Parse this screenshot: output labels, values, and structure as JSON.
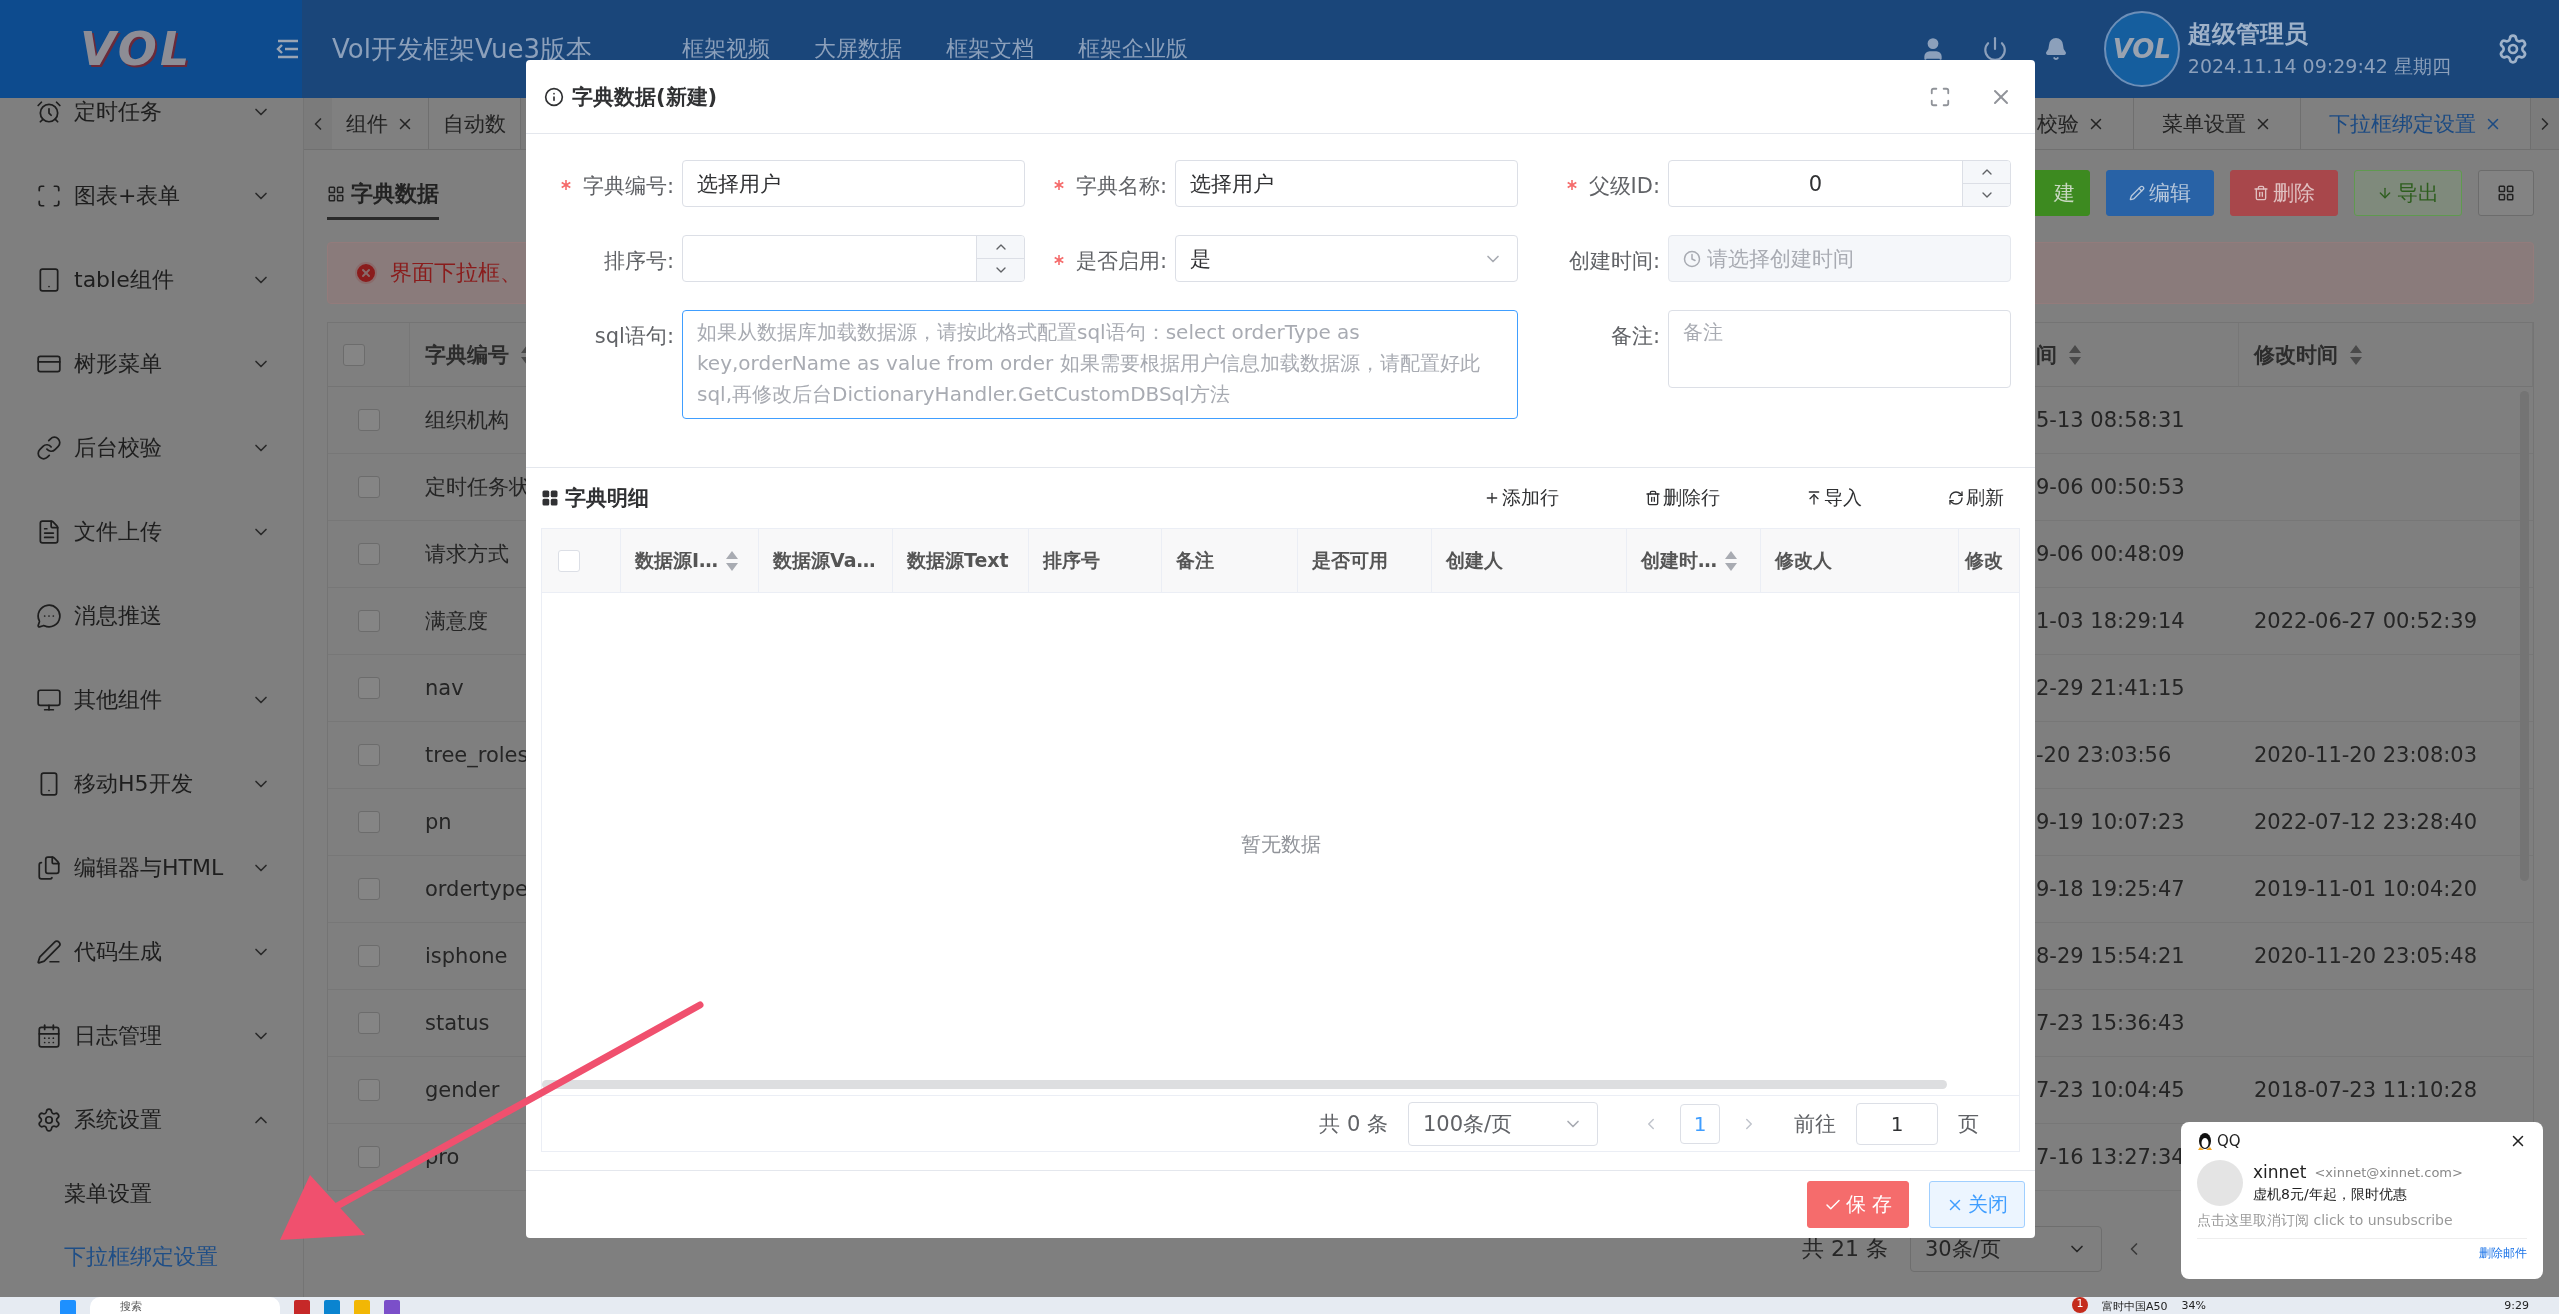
{
  "header": {
    "logo": "VOL",
    "title": "Vol开发框架Vue3版本",
    "nav": [
      "框架视频",
      "大屏数据",
      "框架文档",
      "框架企业版"
    ],
    "user": {
      "avatar_text": "VOL",
      "name": "超级管理员",
      "datetime": "2024.11.14 09:29:42 星期四"
    }
  },
  "sidebar": {
    "items": [
      {
        "kind": "group",
        "label": "定时任务",
        "expanded": false
      },
      {
        "kind": "group",
        "label": "图表+表单",
        "expanded": false
      },
      {
        "kind": "group",
        "label": "table组件",
        "expanded": false
      },
      {
        "kind": "group",
        "label": "树形菜单",
        "expanded": false
      },
      {
        "kind": "group",
        "label": "后台校验",
        "expanded": false
      },
      {
        "kind": "group",
        "label": "文件上传",
        "expanded": false
      },
      {
        "kind": "link",
        "label": "消息推送"
      },
      {
        "kind": "group",
        "label": "其他组件",
        "expanded": false
      },
      {
        "kind": "group",
        "label": "移动H5开发",
        "expanded": false
      },
      {
        "kind": "group",
        "label": "编辑器与HTML",
        "expanded": false
      },
      {
        "kind": "group",
        "label": "代码生成",
        "expanded": false
      },
      {
        "kind": "group",
        "label": "日志管理",
        "expanded": false
      },
      {
        "kind": "group",
        "label": "系统设置",
        "expanded": true,
        "children": [
          {
            "label": "菜单设置",
            "selected": false
          },
          {
            "label": "下拉框绑定设置",
            "selected": true
          }
        ]
      }
    ]
  },
  "tabs": {
    "left": [
      {
        "label": "组件",
        "selected": false,
        "closable": true
      },
      {
        "label": "自动数",
        "selected": false,
        "closable": false
      }
    ],
    "right": [
      {
        "label": "校验",
        "selected": false,
        "closable": true
      },
      {
        "label": "菜单设置",
        "selected": false,
        "closable": true
      },
      {
        "label": "下拉框绑定设置",
        "selected": true,
        "closable": true
      }
    ]
  },
  "content": {
    "title": "字典数据",
    "buttons": [
      {
        "kind": "new",
        "label": "建"
      },
      {
        "kind": "edit",
        "label": "编辑"
      },
      {
        "kind": "delete",
        "label": "删除"
      },
      {
        "kind": "export",
        "label": "导出"
      },
      {
        "kind": "columns"
      }
    ],
    "alert": "界面下拉框、",
    "table": {
      "all_checked": false,
      "columns": [
        {
          "label": "字典编号",
          "sortable": true
        },
        {
          "label": "间",
          "sortable": true
        },
        {
          "label": "修改时间",
          "sortable": true
        }
      ],
      "rows": [
        {
          "checked": false,
          "code": "组织机构",
          "column_2": "5-13 08:58:31"
        },
        {
          "checked": false,
          "code": "定时任务状",
          "column_2": "9-06 00:50:53"
        },
        {
          "checked": false,
          "code": "请求方式",
          "column_2": "9-06 00:48:09"
        },
        {
          "checked": false,
          "code": "满意度",
          "column_2": "1-03 18:29:14",
          "modified": "2022-06-27 00:52:39"
        },
        {
          "checked": false,
          "code": "nav",
          "column_2": "2-29 21:41:15"
        },
        {
          "checked": false,
          "code": "tree_roles",
          "column_2": "-20 23:03:56",
          "modified": "2020-11-20 23:08:03"
        },
        {
          "checked": false,
          "code": "pn",
          "column_2": "9-19 10:07:23",
          "modified": "2022-07-12 23:28:40"
        },
        {
          "checked": false,
          "code": "ordertype",
          "column_2": "9-18 19:25:47",
          "modified": "2019-11-01 10:04:20"
        },
        {
          "checked": false,
          "code": "isphone",
          "column_2": "8-29 15:54:21",
          "modified": "2020-11-20 23:05:48"
        },
        {
          "checked": false,
          "code": "status",
          "column_2": "7-23 15:36:43"
        },
        {
          "checked": false,
          "code": "gender",
          "column_2": "7-23 10:04:45",
          "modified": "2018-07-23 11:10:28"
        },
        {
          "checked": false,
          "code": "pro",
          "column_2": "7-16 13:27:34"
        }
      ]
    },
    "pagination": {
      "total": "共 21 条",
      "page_size": "30条/页"
    }
  },
  "dialog": {
    "title": "字典数据(新建)",
    "fields": [
      {
        "kind": "text",
        "label": "字典编号:",
        "required": true,
        "value": "选择用户"
      },
      {
        "kind": "text",
        "label": "字典名称:",
        "required": true,
        "value": "选择用户"
      },
      {
        "kind": "number",
        "label": "父级ID:",
        "required": true,
        "value": "0"
      },
      {
        "kind": "number",
        "label": "排序号:",
        "required": false
      },
      {
        "kind": "select",
        "label": "是否启用:",
        "required": true,
        "value": "是"
      },
      {
        "kind": "date",
        "label": "创建时间:",
        "required": false,
        "disabled": true,
        "placeholder": "请选择创建时间"
      },
      {
        "kind": "textarea",
        "label": "sql语句:",
        "required": false,
        "focused": true,
        "wide": true,
        "placeholder": "如果从数据库加载数据源，请按此格式配置sql语句：select orderType as key,orderName as value from order  如果需要根据用户信息加载数据源，请配置好此sql,再修改后台DictionaryHandler.GetCustomDBSql方法"
      },
      {
        "kind": "textarea",
        "label": "备注:",
        "required": false,
        "focused": false,
        "wide": false,
        "placeholder": "备注"
      }
    ],
    "detail": {
      "title": "字典明细",
      "actions": [
        {
          "kind": "add",
          "label": "添加行"
        },
        {
          "kind": "delete",
          "label": "删除行"
        },
        {
          "kind": "import",
          "label": "导入"
        },
        {
          "kind": "refresh",
          "label": "刷新"
        }
      ],
      "all_checked": false,
      "columns": [
        {
          "label": "数据源I…",
          "sortable": true
        },
        {
          "label": "数据源Va…",
          "sortable": false
        },
        {
          "label": "数据源Text",
          "sortable": false
        },
        {
          "label": "排序号",
          "sortable": false
        },
        {
          "label": "备注",
          "sortable": false
        },
        {
          "label": "是否可用",
          "sortable": false
        },
        {
          "label": "创建人",
          "sortable": false
        },
        {
          "label": "创建时…",
          "sortable": true
        },
        {
          "label": "修改人",
          "sortable": false
        },
        {
          "label": "修改",
          "sortable": false
        }
      ],
      "empty_text": "暂无数据",
      "pagination": {
        "total": "共 0 条",
        "page_size": "100条/页",
        "current": "1",
        "goto_label": "前往",
        "goto_value": "1",
        "page_suffix": "页"
      }
    },
    "buttons": [
      {
        "kind": "save",
        "label": "保 存"
      },
      {
        "kind": "close",
        "label": "关闭"
      }
    ]
  },
  "notification": {
    "app": "QQ",
    "sender": "xinnet",
    "email": "<xinnet@xinnet.com>",
    "subject": "虚机8元/年起，限时优惠",
    "unsubscribe": "点击这里取消订阅 click to unsubscribe",
    "action": "删除邮件"
  },
  "taskbar": {
    "search": "搜索",
    "badge": "1",
    "widget": "富时中国A50",
    "percent": "34%",
    "clock": "9:29"
  }
}
